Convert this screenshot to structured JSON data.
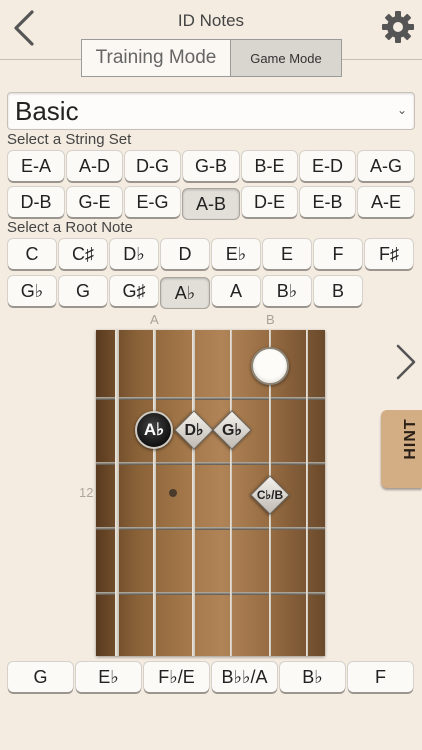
{
  "header": {
    "title": "ID Notes"
  },
  "mode": {
    "training_label": "Training Mode",
    "game_label": "Game Mode"
  },
  "level": {
    "value": "Basic"
  },
  "string_set": {
    "label": "Select a String Set",
    "rows": [
      [
        "E-A",
        "A-D",
        "D-G",
        "G-B",
        "B-E",
        "E-D",
        "A-G"
      ],
      [
        "D-B",
        "G-E",
        "E-G",
        "A-B",
        "D-E",
        "E-B",
        "A-E"
      ]
    ],
    "selected": "A-B"
  },
  "root_note": {
    "label": "Select a Root Note",
    "rows": [
      [
        "C",
        "C♯",
        "D♭",
        "D",
        "E♭",
        "E",
        "F",
        "F♯"
      ],
      [
        "G♭",
        "G",
        "G♯",
        "A♭",
        "A",
        "B♭",
        "B"
      ]
    ],
    "selected": "A♭"
  },
  "fretboard": {
    "string_labels": [
      "A",
      "B"
    ],
    "fret_number": "12",
    "markers": {
      "root": "A♭",
      "d1": "D♭",
      "d2": "G♭",
      "d3": "C♭/B"
    }
  },
  "hint": {
    "label": "HINT"
  },
  "answers": [
    "G",
    "E♭",
    "F♭/E",
    "B♭♭/A",
    "B♭",
    "F"
  ],
  "icons": {
    "back": "back-chevron-icon",
    "settings": "gear-icon",
    "dropdown": "chevron-down-icon",
    "next": "chevron-right-icon"
  }
}
